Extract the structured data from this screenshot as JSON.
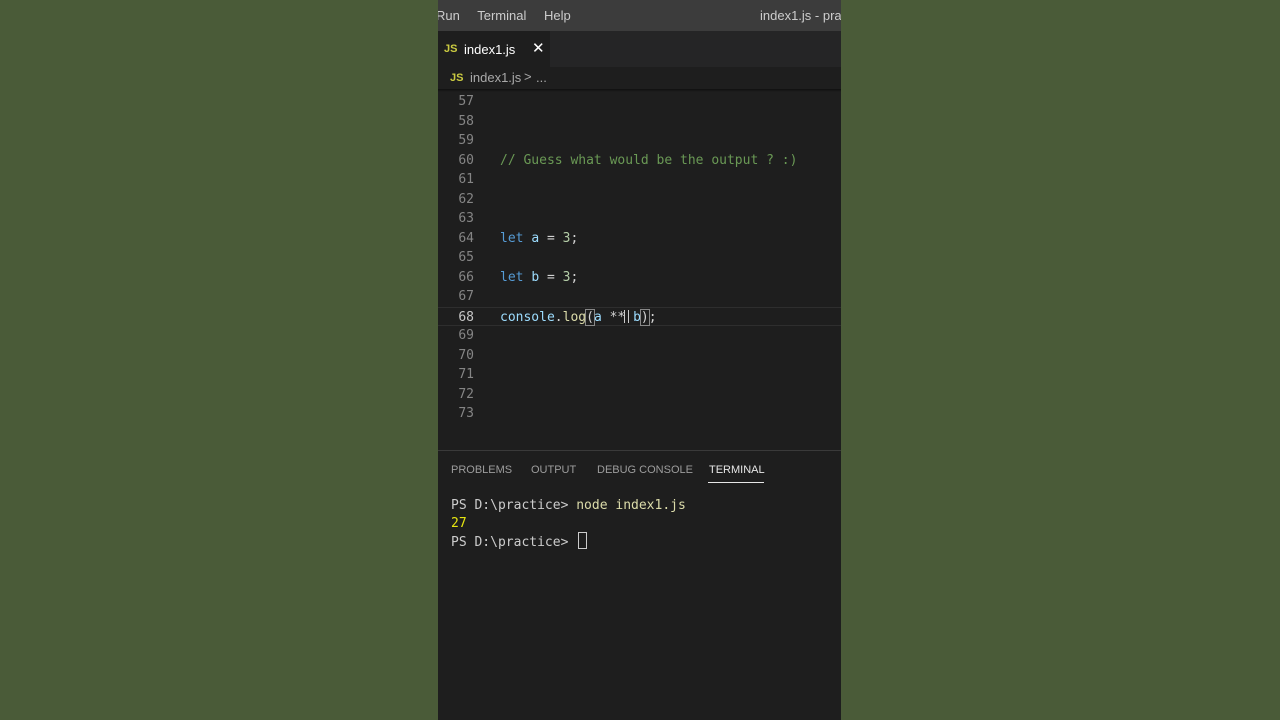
{
  "titlebar": {
    "menus": [
      "Run",
      "Terminal",
      "Help"
    ],
    "window_title": "index1.js - prac"
  },
  "tab": {
    "badge": "JS",
    "label": "index1.js",
    "close_glyph": "✕"
  },
  "breadcrumb": {
    "badge": "JS",
    "file": "index1.js",
    "separator": ">",
    "more": "..."
  },
  "editor": {
    "current_line": 68,
    "lines": [
      {
        "n": "57",
        "t": ""
      },
      {
        "n": "58",
        "t": ""
      },
      {
        "n": "59",
        "t": ""
      },
      {
        "n": "60",
        "t": "// Guess what would be the output ? :)"
      },
      {
        "n": "61",
        "t": ""
      },
      {
        "n": "62",
        "t": ""
      },
      {
        "n": "63",
        "t": ""
      },
      {
        "n": "64",
        "t": "let a = 3;"
      },
      {
        "n": "65",
        "t": ""
      },
      {
        "n": "66",
        "t": "let b = 3;"
      },
      {
        "n": "67",
        "t": ""
      },
      {
        "n": "68",
        "t": "console.log(a ** b);"
      },
      {
        "n": "69",
        "t": ""
      },
      {
        "n": "70",
        "t": ""
      },
      {
        "n": "71",
        "t": ""
      },
      {
        "n": "72",
        "t": ""
      },
      {
        "n": "73",
        "t": ""
      }
    ]
  },
  "panel": {
    "tabs": [
      "PROBLEMS",
      "OUTPUT",
      "DEBUG CONSOLE",
      "TERMINAL"
    ],
    "active_tab": "TERMINAL",
    "terminal": {
      "prompt1": "PS D:\\practice> ",
      "command": "node index1.js",
      "output": "27",
      "prompt2": "PS D:\\practice> "
    }
  },
  "colors": {
    "background": "#4a5b38",
    "editor_bg": "#1e1e1e",
    "comment": "#6a9955",
    "keyword": "#569cd6",
    "js_badge": "#cbcb41"
  }
}
